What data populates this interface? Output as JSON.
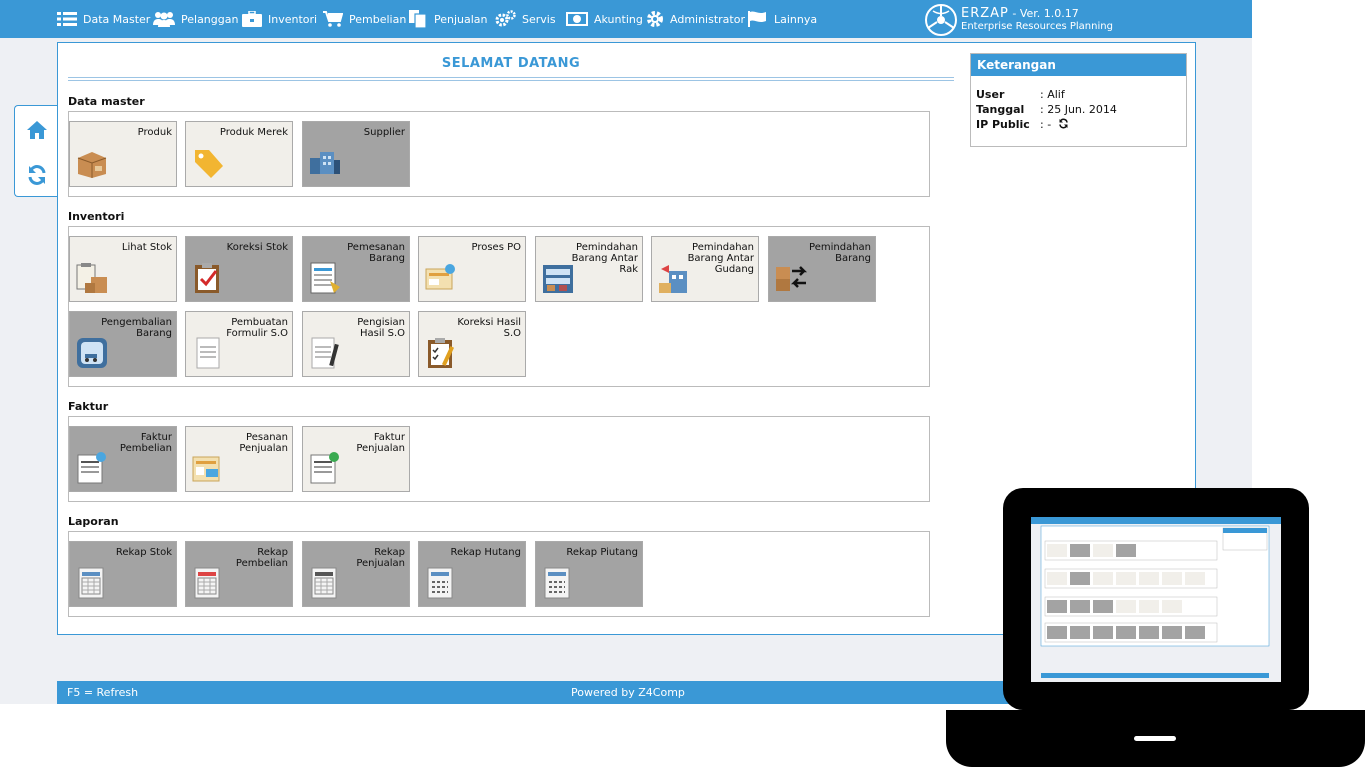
{
  "menu": [
    {
      "label": "Data Master",
      "icon": "list-icon"
    },
    {
      "label": "Pelanggan",
      "icon": "users-icon"
    },
    {
      "label": "Inventori",
      "icon": "briefcase-icon"
    },
    {
      "label": "Pembelian",
      "icon": "cart-icon"
    },
    {
      "label": "Penjualan",
      "icon": "documents-icon"
    },
    {
      "label": "Servis",
      "icon": "cogs-icon"
    },
    {
      "label": "Akunting",
      "icon": "money-icon"
    },
    {
      "label": "Administrator",
      "icon": "gear-icon"
    },
    {
      "label": "Lainnya",
      "icon": "flag-icon"
    }
  ],
  "brand": {
    "name": "ERZAP",
    "version": "- Ver. 1.0.17",
    "subtitle": "Enterprise Resources Planning"
  },
  "page": {
    "title": "SELAMAT DATANG"
  },
  "sections": [
    {
      "title": "Data master",
      "tiles": [
        {
          "label": "Produk",
          "icon": "box-icon",
          "dark": false
        },
        {
          "label": "Produk Merek",
          "icon": "tag-icon",
          "dark": false
        },
        {
          "label": "Supplier",
          "icon": "supplier-icon",
          "dark": true
        }
      ]
    },
    {
      "title": "Inventori",
      "tiles": [
        {
          "label": "Lihat Stok",
          "icon": "stock-icon",
          "dark": false
        },
        {
          "label": "Koreksi Stok",
          "icon": "clipboard-check-icon",
          "dark": true
        },
        {
          "label": "Pemesanan Barang",
          "icon": "order-icon",
          "dark": true
        },
        {
          "label": "Proses PO",
          "icon": "process-icon",
          "dark": false
        },
        {
          "label": "Pemindahan Barang Antar Rak",
          "icon": "rack-icon",
          "dark": false
        },
        {
          "label": "Pemindahan Barang Antar Gudang",
          "icon": "warehouse-icon",
          "dark": false
        },
        {
          "label": "Pemindahan Barang",
          "icon": "transfer-icon",
          "dark": true
        },
        {
          "label": "Pengembalian Barang",
          "icon": "return-icon",
          "dark": true
        },
        {
          "label": "Pembuatan Formulir S.O",
          "icon": "form-icon",
          "dark": false
        },
        {
          "label": "Pengisian Hasil S.O",
          "icon": "fill-form-icon",
          "dark": false
        },
        {
          "label": "Koreksi Hasil S.O",
          "icon": "clipboard-check-icon",
          "dark": false
        }
      ]
    },
    {
      "title": "Faktur",
      "tiles": [
        {
          "label": "Faktur Pembelian",
          "icon": "invoice-icon",
          "dark": true
        },
        {
          "label": "Pesanan Penjualan",
          "icon": "sales-order-icon",
          "dark": false
        },
        {
          "label": "Faktur Penjualan",
          "icon": "invoice-icon",
          "dark": false
        }
      ]
    },
    {
      "title": "Laporan",
      "tiles": [
        {
          "label": "Rekap Stok",
          "icon": "report-icon",
          "dark": true
        },
        {
          "label": "Rekap Pembelian",
          "icon": "report-icon",
          "dark": true
        },
        {
          "label": "Rekap Penjualan",
          "icon": "report-icon",
          "dark": true
        },
        {
          "label": "Rekap Hutang",
          "icon": "report-icon",
          "dark": true
        },
        {
          "label": "Rekap Piutang",
          "icon": "report-icon",
          "dark": true
        }
      ]
    }
  ],
  "info": {
    "title": "Keterangan",
    "user_label": "User",
    "user_value": ": Alif",
    "date_label": "Tanggal",
    "date_value": ": 25 Jun. 2014",
    "ip_label": "IP Public",
    "ip_value": ": -"
  },
  "footer": {
    "left": "F5 = Refresh",
    "center": "Powered by Z4Comp"
  },
  "colors": {
    "accent": "#3a98d6",
    "tile_light": "#f1efea",
    "tile_dark": "#a3a3a3"
  }
}
